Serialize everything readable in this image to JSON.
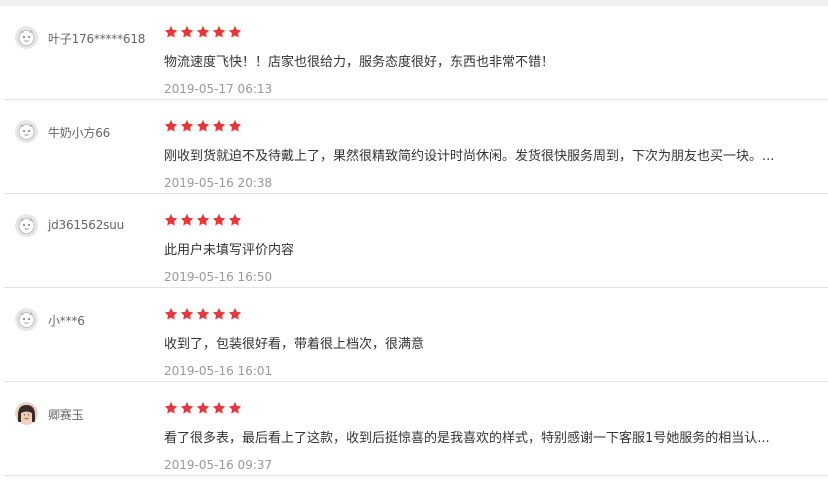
{
  "colors": {
    "star": "#e4393c",
    "background": "#f2f2f2",
    "card": "#ffffff"
  },
  "reviews": [
    {
      "username": "叶子176*****618",
      "avatar": "default-avatar-icon",
      "rating": 5,
      "content": "物流速度飞快！！店家也很给力，服务态度很好，东西也非常不错！",
      "date": "2019-05-17 06:13"
    },
    {
      "username": "牛奶小方66",
      "avatar": "default-avatar-icon",
      "rating": 5,
      "content": "刚收到货就迫不及待戴上了，果然很精致简约设计时尚休闲。发货很快服务周到，下次为朋友也买一块。...",
      "date": "2019-05-16 20:38"
    },
    {
      "username": "jd361562suu",
      "avatar": "default-avatar-icon",
      "rating": 5,
      "content": "此用户未填写评价内容",
      "date": "2019-05-16 16:50"
    },
    {
      "username": "小***6",
      "avatar": "default-avatar-icon",
      "rating": 5,
      "content": "收到了，包装很好看，带着很上档次，很满意",
      "date": "2019-05-16 16:01"
    },
    {
      "username": "卿赛玉",
      "avatar": "user-photo-avatar",
      "rating": 5,
      "content": "看了很多表，最后看上了这款，收到后挺惊喜的是我喜欢的样式，特别感谢一下客服1号她服务的相当认...",
      "date": "2019-05-16 09:37"
    }
  ]
}
